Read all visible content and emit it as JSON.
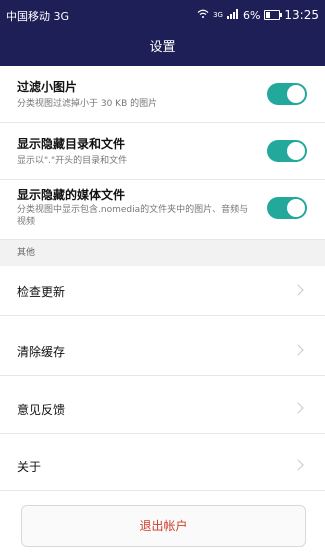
{
  "status_bar": {
    "carrier": "中国移动 3G",
    "signal_label": "3G",
    "battery": "6%",
    "time": "13:25"
  },
  "header": {
    "title": "设置"
  },
  "toggles": [
    {
      "title": "过滤小图片",
      "subtitle": "分类视图过滤掉小于 30 KB 的图片",
      "on": true
    },
    {
      "title": "显示隐藏目录和文件",
      "subtitle": "显示以\".\"开头的目录和文件",
      "on": true
    },
    {
      "title": "显示隐藏的媒体文件",
      "subtitle": "分类视图中显示包含.nomedia的文件夹中的图片、音频与视频",
      "on": true
    }
  ],
  "section": {
    "label": "其他"
  },
  "menu": [
    {
      "label": "检查更新"
    },
    {
      "label": "清除缓存"
    },
    {
      "label": "意见反馈"
    },
    {
      "label": "关于"
    }
  ],
  "logout": {
    "label": "退出帐户"
  },
  "colors": {
    "header_bg": "#1f1f57",
    "toggle_on": "#23a99b",
    "logout_text": "#d23c2c"
  }
}
